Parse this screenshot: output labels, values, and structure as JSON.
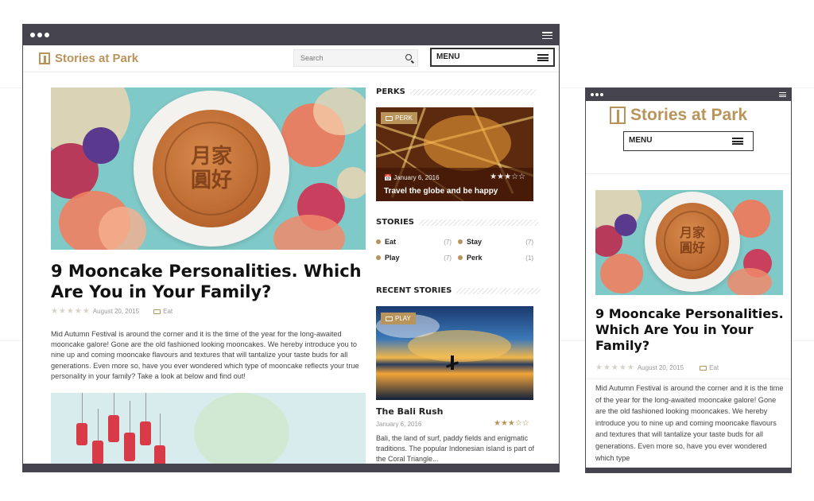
{
  "desktop": {
    "brand": "Stories at Park",
    "search_placeholder": "Search",
    "menu_label": "MENU",
    "article": {
      "title": "9 Mooncake Personalities. Which Are You in Your Family?",
      "stars": "★★★★★",
      "date": "August 20, 2015",
      "category": "Eat",
      "image_text": "月家圓好",
      "body": "Mid Autumn Festival is around the corner and it is the time of the year for the long-awaited mooncake galore! Gone are the old fashioned looking mooncakes. We hereby introduce you to nine up and coming mooncake flavours and textures that will tantalize your taste buds for all generations. Even more so, have you ever wondered which type of mooncake reflects your true personality in your family? Take a look at below and find out!"
    },
    "sidebar": {
      "perks_heading": "PERKS",
      "perk": {
        "badge": "PERK",
        "date": "January 6, 2016",
        "stars": "★★★☆☆",
        "title": "Travel the globe and be happy"
      },
      "stories_heading": "STORIES",
      "categories": [
        {
          "label": "Eat",
          "count": "(7)"
        },
        {
          "label": "Stay",
          "count": "(7)"
        },
        {
          "label": "Play",
          "count": "(7)"
        },
        {
          "label": "Perk",
          "count": "(1)"
        }
      ],
      "recent_heading": "RECENT STORIES",
      "recent": {
        "badge": "PLAY",
        "title": "The Bali Rush",
        "date": "January 6, 2016",
        "stars": "★★★☆☆",
        "excerpt": "Bali, the land of surf, paddy fields and enigmatic traditions. The popular Indonesian island is part of the Coral Triangle..."
      }
    }
  },
  "mobile": {
    "brand": "Stories at Park",
    "menu_label": "MENU",
    "article": {
      "title": "9 Mooncake Personalities. Which Are You in Your Family?",
      "stars": "★★★★★",
      "date": "August 20, 2015",
      "category": "Eat",
      "body": "Mid Autumn Festival is around the corner and it is the time of the year for the long-awaited mooncake galore! Gone are the old fashioned looking mooncakes. We hereby introduce you to nine up and coming mooncake flavours and textures that will tantalize your taste buds for all generations. Even more so, have you ever wondered which type"
    }
  },
  "colors": {
    "brand_gold": "#b8945a",
    "chrome_dark": "#44434e",
    "teal_bg": "#7fc9c8"
  }
}
